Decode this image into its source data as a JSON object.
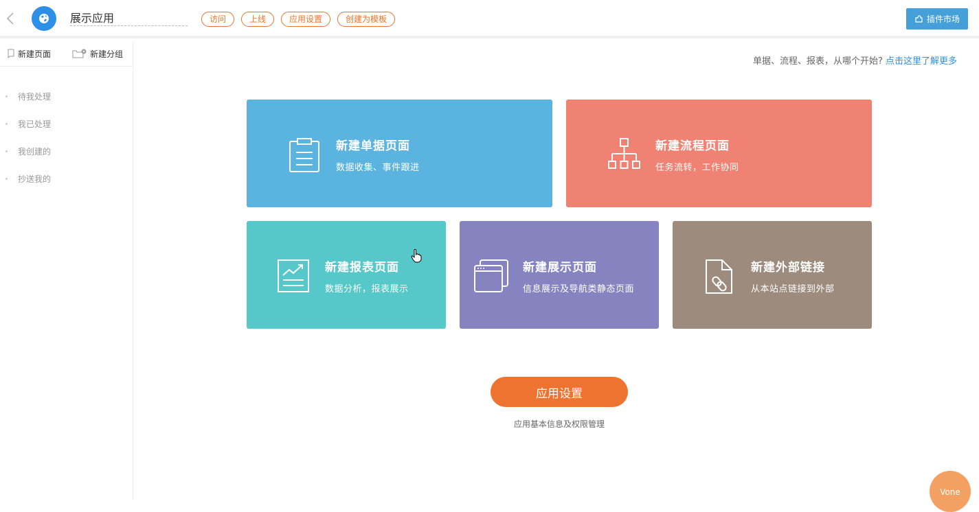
{
  "header": {
    "app_name": "展示应用",
    "tags": [
      "访问",
      "上线",
      "应用设置",
      "创建为模板"
    ],
    "plugin_market": "插件市场",
    "accent": "#e9742b",
    "plugin_color": "#45a0d8"
  },
  "sidebar": {
    "new_page": "新建页面",
    "new_group": "新建分组",
    "items": [
      "待我处理",
      "我已处理",
      "我创建的",
      "抄送我的"
    ]
  },
  "main": {
    "hint_text": "单据、流程、报表，从哪个开始?",
    "hint_link": "点击这里了解更多",
    "cards": [
      {
        "title": "新建单据页面",
        "desc": "数据收集、事件跟进",
        "icon": "clipboard-icon",
        "color": "#5bb4df"
      },
      {
        "title": "新建流程页面",
        "desc": "任务流转，工作协同",
        "icon": "flowchart-icon",
        "color": "#f08273"
      },
      {
        "title": "新建报表页面",
        "desc": "数据分析，报表展示",
        "icon": "chart-icon",
        "color": "#57c8c9"
      },
      {
        "title": "新建展示页面",
        "desc": "信息展示及导航类静态页面",
        "icon": "window-icon",
        "color": "#8684c0"
      },
      {
        "title": "新建外部链接",
        "desc": "从本站点链接到外部",
        "icon": "link-file-icon",
        "color": "#9d8b7e"
      }
    ],
    "settings_button": "应用设置",
    "settings_desc": "应用基本信息及权限管理"
  },
  "assistant": {
    "label": "Vone"
  }
}
